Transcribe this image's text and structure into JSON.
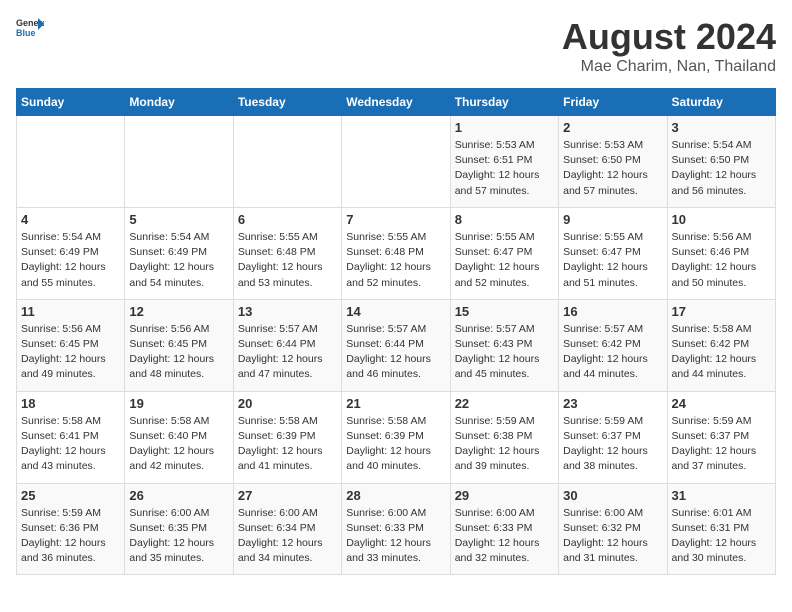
{
  "header": {
    "logo_general": "General",
    "logo_blue": "Blue",
    "main_title": "August 2024",
    "subtitle": "Mae Charim, Nan, Thailand"
  },
  "days_of_week": [
    "Sunday",
    "Monday",
    "Tuesday",
    "Wednesday",
    "Thursday",
    "Friday",
    "Saturday"
  ],
  "weeks": [
    [
      {
        "day": "",
        "detail": ""
      },
      {
        "day": "",
        "detail": ""
      },
      {
        "day": "",
        "detail": ""
      },
      {
        "day": "",
        "detail": ""
      },
      {
        "day": "1",
        "detail": "Sunrise: 5:53 AM\nSunset: 6:51 PM\nDaylight: 12 hours\nand 57 minutes."
      },
      {
        "day": "2",
        "detail": "Sunrise: 5:53 AM\nSunset: 6:50 PM\nDaylight: 12 hours\nand 57 minutes."
      },
      {
        "day": "3",
        "detail": "Sunrise: 5:54 AM\nSunset: 6:50 PM\nDaylight: 12 hours\nand 56 minutes."
      }
    ],
    [
      {
        "day": "4",
        "detail": "Sunrise: 5:54 AM\nSunset: 6:49 PM\nDaylight: 12 hours\nand 55 minutes."
      },
      {
        "day": "5",
        "detail": "Sunrise: 5:54 AM\nSunset: 6:49 PM\nDaylight: 12 hours\nand 54 minutes."
      },
      {
        "day": "6",
        "detail": "Sunrise: 5:55 AM\nSunset: 6:48 PM\nDaylight: 12 hours\nand 53 minutes."
      },
      {
        "day": "7",
        "detail": "Sunrise: 5:55 AM\nSunset: 6:48 PM\nDaylight: 12 hours\nand 52 minutes."
      },
      {
        "day": "8",
        "detail": "Sunrise: 5:55 AM\nSunset: 6:47 PM\nDaylight: 12 hours\nand 52 minutes."
      },
      {
        "day": "9",
        "detail": "Sunrise: 5:55 AM\nSunset: 6:47 PM\nDaylight: 12 hours\nand 51 minutes."
      },
      {
        "day": "10",
        "detail": "Sunrise: 5:56 AM\nSunset: 6:46 PM\nDaylight: 12 hours\nand 50 minutes."
      }
    ],
    [
      {
        "day": "11",
        "detail": "Sunrise: 5:56 AM\nSunset: 6:45 PM\nDaylight: 12 hours\nand 49 minutes."
      },
      {
        "day": "12",
        "detail": "Sunrise: 5:56 AM\nSunset: 6:45 PM\nDaylight: 12 hours\nand 48 minutes."
      },
      {
        "day": "13",
        "detail": "Sunrise: 5:57 AM\nSunset: 6:44 PM\nDaylight: 12 hours\nand 47 minutes."
      },
      {
        "day": "14",
        "detail": "Sunrise: 5:57 AM\nSunset: 6:44 PM\nDaylight: 12 hours\nand 46 minutes."
      },
      {
        "day": "15",
        "detail": "Sunrise: 5:57 AM\nSunset: 6:43 PM\nDaylight: 12 hours\nand 45 minutes."
      },
      {
        "day": "16",
        "detail": "Sunrise: 5:57 AM\nSunset: 6:42 PM\nDaylight: 12 hours\nand 44 minutes."
      },
      {
        "day": "17",
        "detail": "Sunrise: 5:58 AM\nSunset: 6:42 PM\nDaylight: 12 hours\nand 44 minutes."
      }
    ],
    [
      {
        "day": "18",
        "detail": "Sunrise: 5:58 AM\nSunset: 6:41 PM\nDaylight: 12 hours\nand 43 minutes."
      },
      {
        "day": "19",
        "detail": "Sunrise: 5:58 AM\nSunset: 6:40 PM\nDaylight: 12 hours\nand 42 minutes."
      },
      {
        "day": "20",
        "detail": "Sunrise: 5:58 AM\nSunset: 6:39 PM\nDaylight: 12 hours\nand 41 minutes."
      },
      {
        "day": "21",
        "detail": "Sunrise: 5:58 AM\nSunset: 6:39 PM\nDaylight: 12 hours\nand 40 minutes."
      },
      {
        "day": "22",
        "detail": "Sunrise: 5:59 AM\nSunset: 6:38 PM\nDaylight: 12 hours\nand 39 minutes."
      },
      {
        "day": "23",
        "detail": "Sunrise: 5:59 AM\nSunset: 6:37 PM\nDaylight: 12 hours\nand 38 minutes."
      },
      {
        "day": "24",
        "detail": "Sunrise: 5:59 AM\nSunset: 6:37 PM\nDaylight: 12 hours\nand 37 minutes."
      }
    ],
    [
      {
        "day": "25",
        "detail": "Sunrise: 5:59 AM\nSunset: 6:36 PM\nDaylight: 12 hours\nand 36 minutes."
      },
      {
        "day": "26",
        "detail": "Sunrise: 6:00 AM\nSunset: 6:35 PM\nDaylight: 12 hours\nand 35 minutes."
      },
      {
        "day": "27",
        "detail": "Sunrise: 6:00 AM\nSunset: 6:34 PM\nDaylight: 12 hours\nand 34 minutes."
      },
      {
        "day": "28",
        "detail": "Sunrise: 6:00 AM\nSunset: 6:33 PM\nDaylight: 12 hours\nand 33 minutes."
      },
      {
        "day": "29",
        "detail": "Sunrise: 6:00 AM\nSunset: 6:33 PM\nDaylight: 12 hours\nand 32 minutes."
      },
      {
        "day": "30",
        "detail": "Sunrise: 6:00 AM\nSunset: 6:32 PM\nDaylight: 12 hours\nand 31 minutes."
      },
      {
        "day": "31",
        "detail": "Sunrise: 6:01 AM\nSunset: 6:31 PM\nDaylight: 12 hours\nand 30 minutes."
      }
    ]
  ]
}
